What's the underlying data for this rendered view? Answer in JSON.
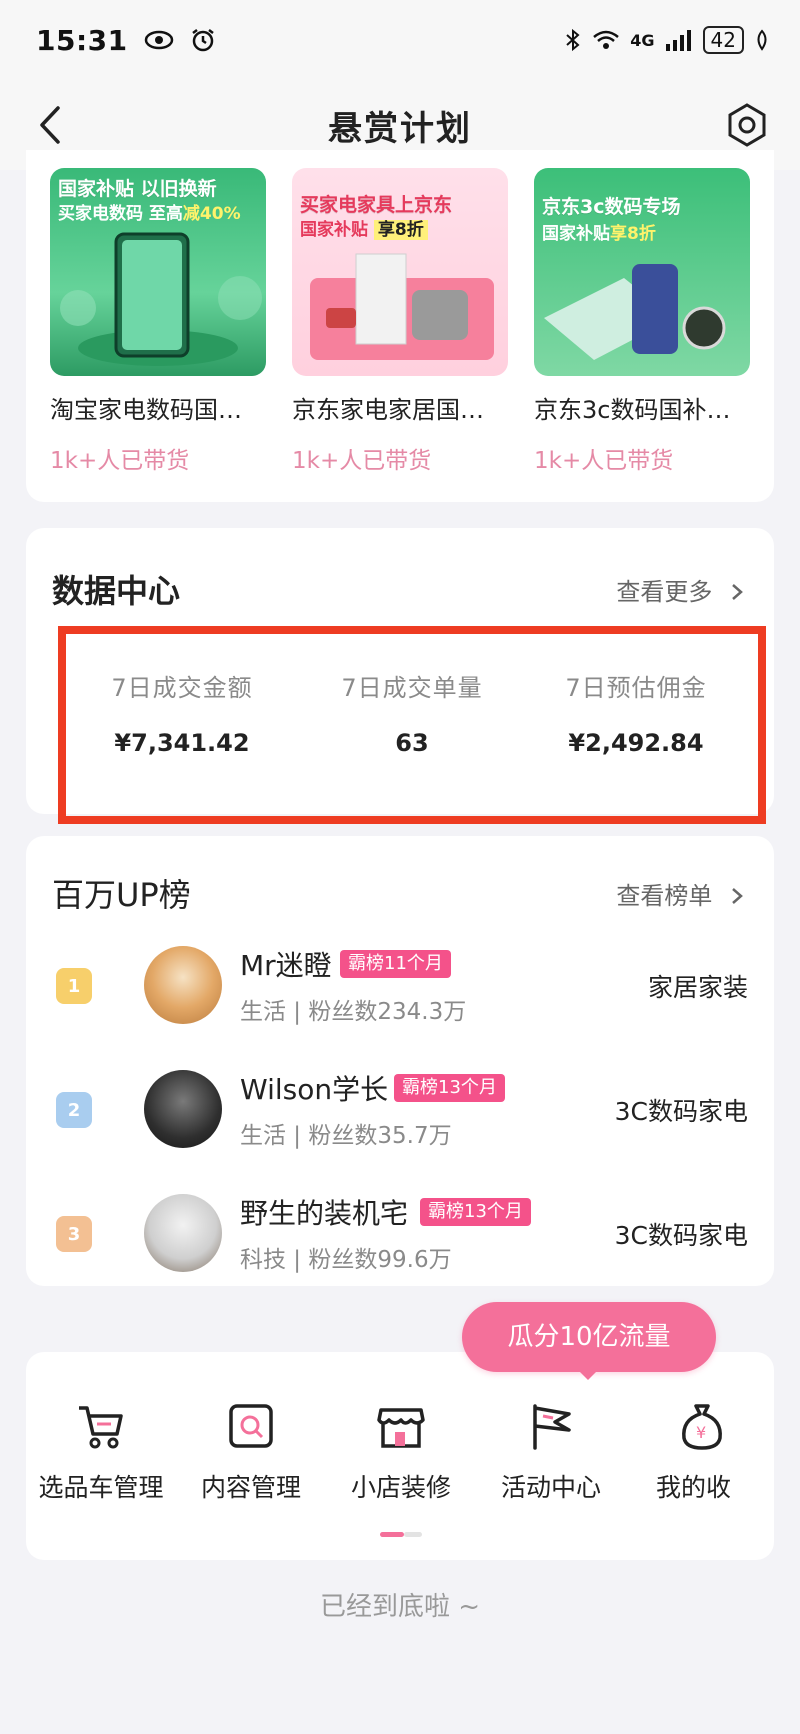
{
  "status_bar": {
    "time": "15:31",
    "network": "4G",
    "battery": "42"
  },
  "nav": {
    "title": "悬赏计划"
  },
  "subsidy": {
    "items": [
      {
        "banner_line1": "国家补贴 以旧换新",
        "banner_line2_pre": "买家电数码 至高",
        "banner_line2_hl": "减40%",
        "title": "淘宝家电数码国…",
        "sales": "1k+人已带货"
      },
      {
        "banner_line1": "买家电家具上京东",
        "banner_line2_pre": "国家补贴 ",
        "banner_line2_hl": "享8折",
        "title": "京东家电家居国…",
        "sales": "1k+人已带货"
      },
      {
        "banner_line1": "京东3c数码专场",
        "banner_line2_pre": "国家补贴",
        "banner_line2_hl": "享8折",
        "title": "京东3c数码国补…",
        "sales": "1k+人已带货"
      }
    ]
  },
  "data_center": {
    "title": "数据中心",
    "more": "查看更多",
    "metrics": [
      {
        "label": "7日成交金额",
        "value": "¥7,341.42"
      },
      {
        "label": "7日成交单量",
        "value": "63"
      },
      {
        "label": "7日预估佣金",
        "value": "¥2,492.84"
      }
    ]
  },
  "rank": {
    "title": "百万UP榜",
    "more": "查看榜单",
    "rows": [
      {
        "rank": "1",
        "name": "Mr迷瞪",
        "tag": "霸榜11个月",
        "sub": "生活 | 粉丝数234.3万",
        "category": "家居家装"
      },
      {
        "rank": "2",
        "name": "Wilson学长",
        "tag": "霸榜13个月",
        "sub": "生活 | 粉丝数35.7万",
        "category": "3C数码家电"
      },
      {
        "rank": "3",
        "name": "野生的装机宅",
        "tag": "霸榜13个月",
        "sub": "科技 | 粉丝数99.6万",
        "category": "3C数码家电"
      }
    ]
  },
  "tools": {
    "bubble": "瓜分10亿流量",
    "items": [
      {
        "label": "选品车管理",
        "icon": "cart-icon"
      },
      {
        "label": "内容管理",
        "icon": "search-doc-icon"
      },
      {
        "label": "小店装修",
        "icon": "shop-icon"
      },
      {
        "label": "活动中心",
        "icon": "flag-icon"
      },
      {
        "label": "我的收",
        "icon": "money-bag-icon"
      }
    ]
  },
  "footer": "已经到底啦 ~",
  "colors": {
    "accent_pink": "#f4709a",
    "highlight_red": "#ee3c22",
    "sales_pink": "#e58aa6"
  }
}
